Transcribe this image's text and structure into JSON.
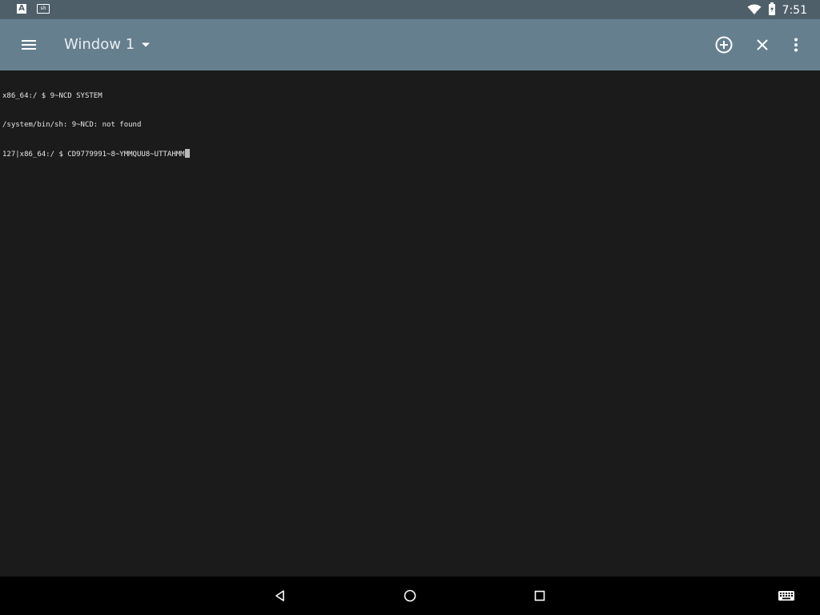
{
  "status_bar": {
    "time": "7:51",
    "notification_icons": [
      "text-a-icon",
      "terminal-notification-icon"
    ],
    "system_icons": [
      "wifi-icon",
      "battery-icon"
    ],
    "notif_a_label": "A",
    "notif_term_label": "sh"
  },
  "toolbar": {
    "title": "Window 1",
    "actions": [
      "new-window",
      "close-window",
      "more-options"
    ]
  },
  "terminal": {
    "lines": [
      "x86_64:/ $ 9~NCD SYSTEM",
      "/system/bin/sh: 9~NCD: not found",
      "127|x86_64:/ $ CD9779991~8~YMMQUU8~UTTAHMM"
    ]
  },
  "colors": {
    "status_bar": "#4f5f6a",
    "toolbar": "#667f8f",
    "terminal_bg": "#1b1b1b",
    "terminal_fg": "#e6e6e6",
    "nav_bar": "#000000"
  }
}
